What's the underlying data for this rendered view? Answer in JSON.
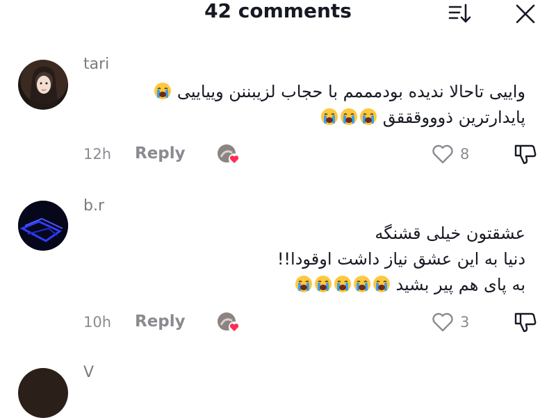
{
  "header": {
    "title": "42 comments"
  },
  "icons": {
    "sort": "sort-icon",
    "close": "close-icon",
    "like": "heart-outline-icon",
    "dislike": "thumbs-down-icon",
    "emoji": "loudly-crying-face-emoji"
  },
  "comments": [
    {
      "username": "tari",
      "lines": [
        "واییی تاحالا ندیده بودمممم با حجاب لزیبننن وییاییی",
        "پایدارترین ذوووقققق"
      ],
      "time": "12h",
      "reply_label": "Reply",
      "likes": "8"
    },
    {
      "username": "b.r",
      "lines": [
        "عشقتون خیلی قشنگه",
        "دنیا به این عشق نیاز داشت اوقودا!!",
        "به پای هم پیر بشید"
      ],
      "time": "10h",
      "reply_label": "Reply",
      "likes": "3"
    },
    {
      "username": "V"
    }
  ]
}
